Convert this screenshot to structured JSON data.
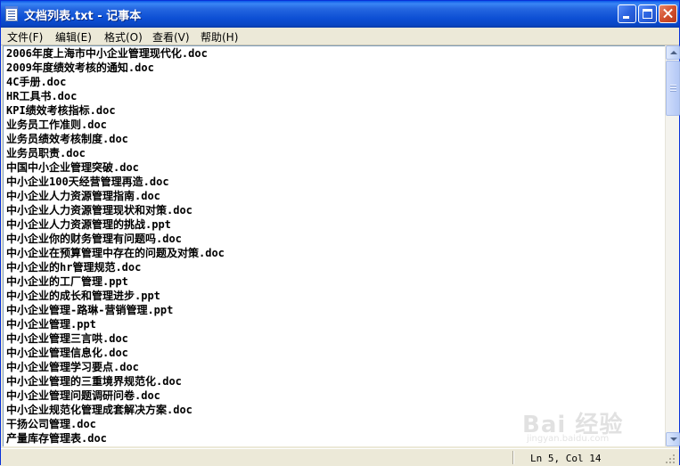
{
  "window": {
    "title": "文档列表.txt - 记事本",
    "accent": "#0A46C4"
  },
  "controls": {
    "minimize_icon": "minimize-icon",
    "maximize_icon": "maximize-icon",
    "close_icon": "close-icon"
  },
  "menu": [
    {
      "label": "文件(F)"
    },
    {
      "label": "编辑(E)"
    },
    {
      "label": "格式(O)"
    },
    {
      "label": "查看(V)"
    },
    {
      "label": "帮助(H)"
    }
  ],
  "lines": [
    "2006年度上海市中小企业管理现代化.doc",
    "2009年度绩效考核的通知.doc",
    "4C手册.doc",
    "HR工具书.doc",
    "KPI绩效考核指标.doc",
    "业务员工作准则.doc",
    "业务员绩效考核制度.doc",
    "业务员职责.doc",
    "中国中小企业管理突破.doc",
    "中小企业100天经营管理再造.doc",
    "中小企业人力资源管理指南.doc",
    "中小企业人力资源管理现状和对策.doc",
    "中小企业人力资源管理的挑战.ppt",
    "中小企业你的财务管理有问题吗.doc",
    "中小企业在预算管理中存在的问题及对策.doc",
    "中小企业的hr管理规范.doc",
    "中小企业的工厂管理.ppt",
    "中小企业的成长和管理进步.ppt",
    "中小企业管理-路琳-营销管理.ppt",
    "中小企业管理.ppt",
    "中小企业管理三言哄.doc",
    "中小企业管理信息化.doc",
    "中小企业管理学习要点.doc",
    "中小企业管理的三重境界规范化.doc",
    "中小企业管理问题调研问卷.doc",
    "中小企业规范化管理成套解决方案.doc",
    "干扬公司管理.doc",
    "产量库存管理表.doc"
  ],
  "status": {
    "position": "Ln 5, Col 14"
  },
  "watermark": {
    "main": "Bai 经验",
    "sub": "jingyan.baidu.com"
  }
}
